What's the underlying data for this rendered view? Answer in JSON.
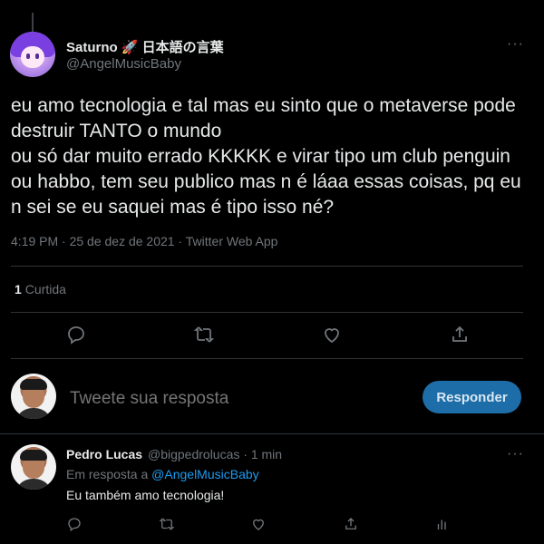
{
  "tweet": {
    "author_name": "Saturno 🚀 日本語の言葉",
    "author_handle": "@AngelMusicBaby",
    "text": "eu amo tecnologia e tal mas eu sinto que o metaverse pode destruir TANTO o mundo\nou só dar muito errado KKKKK e virar tipo um club penguin ou habbo, tem seu publico mas n é láaa essas coisas, pq eu n sei se eu saquei mas é tipo isso né?",
    "meta": "4:19 PM · 25 de dez de 2021 · Twitter Web App",
    "likes_count": "1",
    "likes_label": "Curtida",
    "more_label": "···"
  },
  "reply_box": {
    "placeholder": "Tweete sua resposta",
    "button_label": "Responder"
  },
  "reply": {
    "author_name": "Pedro Lucas",
    "author_handle_time": "@bigpedrolucas · 1 min",
    "in_reply_to_prefix": "Em resposta a ",
    "in_reply_to_handle": "@AngelMusicBaby",
    "text": "Eu também amo tecnologia!",
    "more_label": "···"
  },
  "icons": {
    "reply": "comment-icon",
    "retweet": "retweet-icon",
    "like": "heart-icon",
    "share": "share-icon",
    "analytics": "analytics-icon"
  },
  "colors": {
    "background": "#000000",
    "text_primary": "#e7e9ea",
    "text_secondary": "#71767b",
    "accent": "#1d9bf0",
    "button_bg": "#1d6ea8",
    "divider": "#2f3336"
  }
}
